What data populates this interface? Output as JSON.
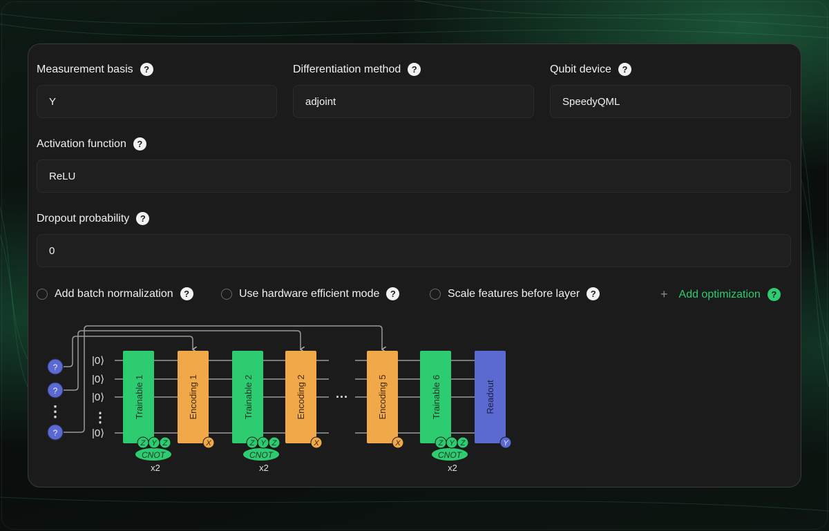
{
  "fields": {
    "measurement_basis": {
      "label": "Measurement basis",
      "value": "Y"
    },
    "differentiation_method": {
      "label": "Differentiation method",
      "value": "adjoint"
    },
    "qubit_device": {
      "label": "Qubit device",
      "value": "SpeedyQML"
    },
    "activation_function": {
      "label": "Activation function",
      "value": "ReLU"
    },
    "dropout_probability": {
      "label": "Dropout probability",
      "value": "0"
    }
  },
  "help_glyph": "?",
  "options": {
    "batch_norm": "Add batch normalization",
    "hardware_efficient": "Use hardware efficient mode",
    "scale_features": "Scale features before layer",
    "add_optimization": "Add optimization",
    "add_symbol": "+"
  },
  "diagram": {
    "input_badge": "?",
    "qubit_label": "|0⟩",
    "ellipsis": "⋮",
    "mid_ellipsis": "···",
    "blocks": [
      {
        "label": "Trainable 1",
        "kind": "trainable",
        "gates": [
          "Z",
          "Y",
          "Z"
        ],
        "entangler": "CNOT",
        "repeat": "x2"
      },
      {
        "label": "Encoding 1",
        "kind": "encoding",
        "gate": "X"
      },
      {
        "label": "Trainable 2",
        "kind": "trainable",
        "gates": [
          "Z",
          "Y",
          "Z"
        ],
        "entangler": "CNOT",
        "repeat": "x2"
      },
      {
        "label": "Encoding 2",
        "kind": "encoding",
        "gate": "X"
      },
      {
        "label": "Encoding 5",
        "kind": "encoding",
        "gate": "X"
      },
      {
        "label": "Trainable 6",
        "kind": "trainable",
        "gates": [
          "Z",
          "Y",
          "Z"
        ],
        "entangler": "CNOT",
        "repeat": "x2"
      },
      {
        "label": "Readout",
        "kind": "readout",
        "gate": "Y"
      }
    ],
    "colors": {
      "trainable": "#2ecc71",
      "encoding": "#f0a848",
      "readout": "#5a6ad0",
      "badge": "#5a6ad0"
    }
  }
}
